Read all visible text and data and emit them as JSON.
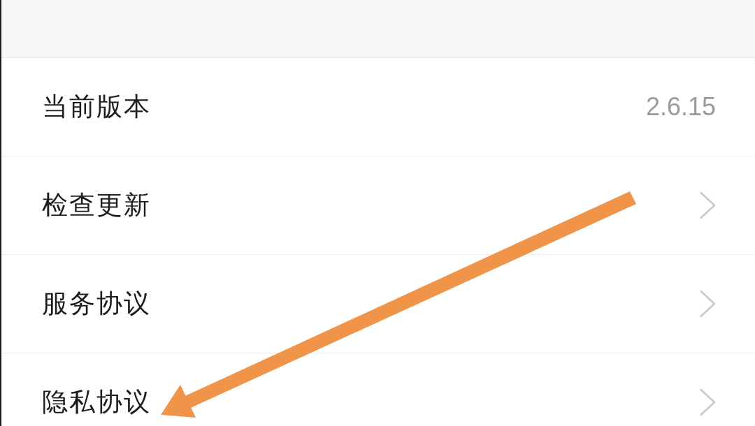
{
  "settings": [
    {
      "label": "当前版本",
      "kind": "value",
      "value": "2.6.15"
    },
    {
      "label": "检查更新",
      "kind": "link"
    },
    {
      "label": "服务协议",
      "kind": "link"
    },
    {
      "label": "隐私协议",
      "kind": "link"
    }
  ]
}
